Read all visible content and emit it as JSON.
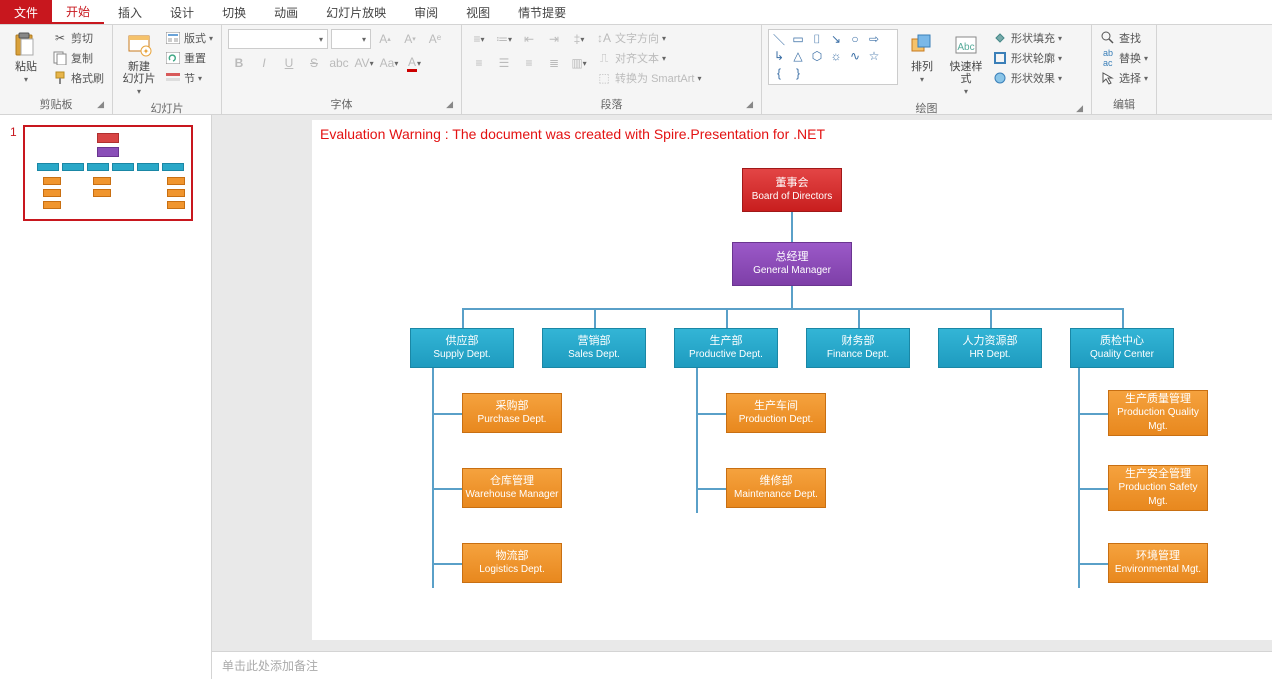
{
  "tabs": {
    "file": "文件",
    "start": "开始",
    "insert": "插入",
    "design": "设计",
    "transition": "切换",
    "animation": "动画",
    "slideshow": "幻灯片放映",
    "review": "审阅",
    "view": "视图",
    "storyline": "情节提要"
  },
  "ribbon": {
    "clipboard": {
      "title": "剪贴板",
      "paste": "粘贴",
      "cut": "剪切",
      "copy": "复制",
      "format_painter": "格式刷"
    },
    "slides": {
      "title": "幻灯片",
      "new_slide": "新建\n幻灯片",
      "layout": "版式",
      "reset": "重置",
      "section": "节"
    },
    "font": {
      "title": "字体"
    },
    "paragraph": {
      "title": "段落",
      "text_direction": "文字方向",
      "align_text": "对齐文本",
      "convert_smartart": "转换为 SmartArt"
    },
    "drawing": {
      "title": "绘图",
      "arrange": "排列",
      "quick_styles": "快速样式",
      "shape_fill": "形状填充",
      "shape_outline": "形状轮廓",
      "shape_effects": "形状效果"
    },
    "editing": {
      "title": "编辑",
      "find": "查找",
      "replace": "替换",
      "select": "选择"
    }
  },
  "warning": "Evaluation Warning : The document was created with  Spire.Presentation for .NET",
  "notes_placeholder": "单击此处添加备注",
  "thumb_number": "1",
  "org": {
    "root": {
      "cn": "董事会",
      "en": "Board of Directors"
    },
    "gm": {
      "cn": "总经理",
      "en": "General Manager"
    },
    "depts": [
      {
        "cn": "供应部",
        "en": "Supply Dept."
      },
      {
        "cn": "营销部",
        "en": "Sales Dept."
      },
      {
        "cn": "生产部",
        "en": "Productive Dept."
      },
      {
        "cn": "财务部",
        "en": "Finance Dept."
      },
      {
        "cn": "人力资源部",
        "en": "HR Dept."
      },
      {
        "cn": "质检中心",
        "en": "Quality Center"
      }
    ],
    "supply_children": [
      {
        "cn": "采购部",
        "en": "Purchase Dept."
      },
      {
        "cn": "仓库管理",
        "en": "Warehouse Manager"
      },
      {
        "cn": "物流部",
        "en": "Logistics Dept."
      }
    ],
    "prod_children": [
      {
        "cn": "生产车间",
        "en": "Production Dept."
      },
      {
        "cn": "维修部",
        "en": "Maintenance Dept."
      }
    ],
    "qc_children": [
      {
        "cn": "生产质量管理",
        "en": "Production Quality Mgt."
      },
      {
        "cn": "生产安全管理",
        "en": "Production Safety Mgt."
      },
      {
        "cn": "环境管理",
        "en": "Environmental Mgt."
      }
    ]
  }
}
